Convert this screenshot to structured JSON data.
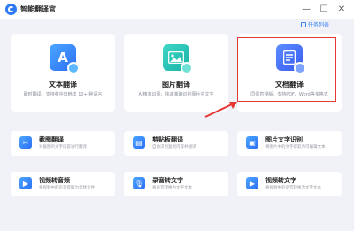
{
  "titlebar": {
    "app_title": "智能翻译官",
    "minimize": "—",
    "maximize": "☐",
    "close": "✕"
  },
  "task_list": "任务列表",
  "big_cards": [
    {
      "id": "text-translate",
      "title": "文本翻译",
      "desc": "即时翻译，支持英中日韩法 10+ 种语言",
      "icon_glyph": "A"
    },
    {
      "id": "image-translate",
      "title": "图片翻译",
      "desc": "AI精准识图，快速准确识别图片中文字",
      "icon_glyph": ""
    },
    {
      "id": "doc-translate",
      "title": "文档翻译",
      "desc": "同保直排版，支持PDF、Word等多格式",
      "icon_glyph": ""
    }
  ],
  "small_cards": [
    {
      "id": "screenshot-translate",
      "title": "截图翻译",
      "desc": "对截图的文字内容进行翻译"
    },
    {
      "id": "clipboard-translate",
      "title": "剪贴板翻译",
      "desc": "自动识别复制内容并翻译"
    },
    {
      "id": "image-ocr",
      "title": "图片文字识别",
      "desc": "将图片中的文字提取为可编辑文本"
    },
    {
      "id": "video-to-audio",
      "title": "视频转音频",
      "desc": "将视频中的声音提取为音频文件"
    },
    {
      "id": "recording-to-text",
      "title": "录音转文字",
      "desc": "将录音转换为文字文本"
    },
    {
      "id": "video-to-text",
      "title": "视频转文字",
      "desc": "将视频中的语音转换为文字文本"
    }
  ],
  "colors": {
    "accent": "#2f7bf6",
    "highlight": "#e53935",
    "background": "#f0f2f7"
  }
}
